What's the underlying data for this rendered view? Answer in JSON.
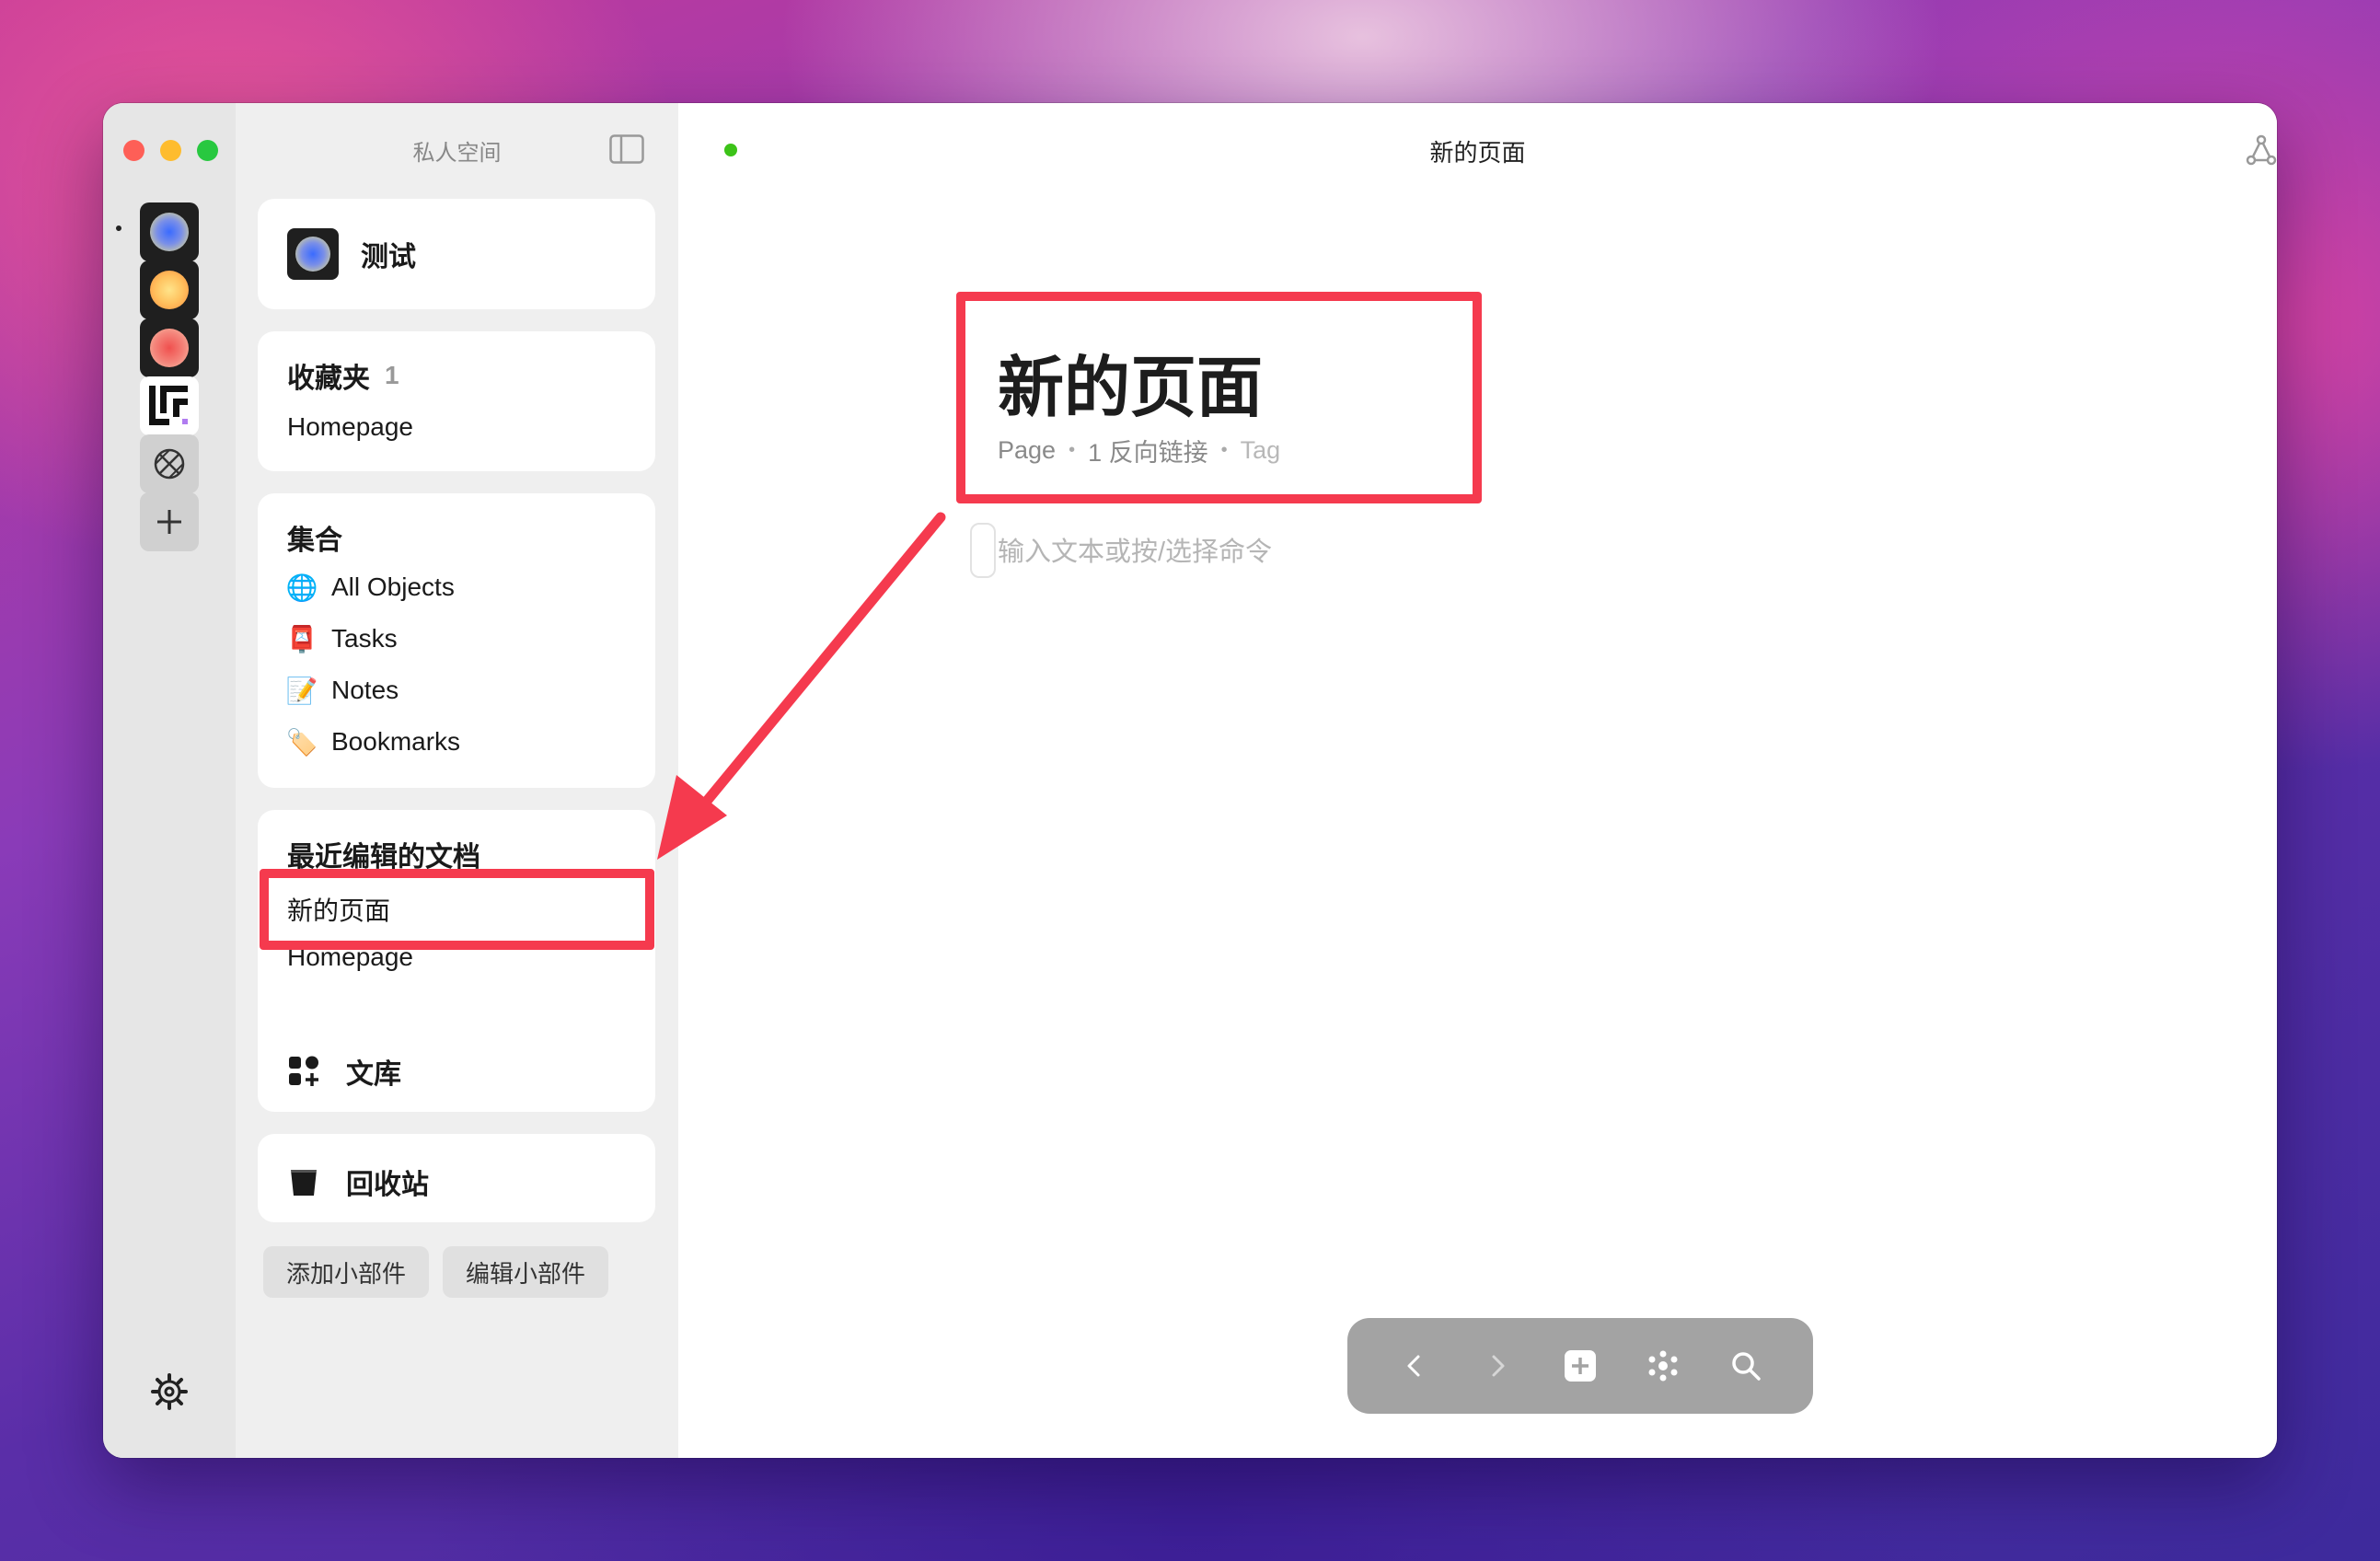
{
  "window": {
    "traffic_lights": [
      "close",
      "minimize",
      "zoom"
    ]
  },
  "spaces": {
    "items": [
      {
        "name": "space-blue",
        "colors": [
          "#2f6bff",
          "#f3e87a"
        ]
      },
      {
        "name": "space-orange",
        "colors": [
          "#ffd166",
          "#ff8c42"
        ]
      },
      {
        "name": "space-red",
        "colors": [
          "#ff6b5e",
          "#f7a8a0"
        ]
      },
      {
        "name": "space-logo",
        "glyph": "Ꮃ"
      },
      {
        "name": "space-globe",
        "icon": "globe-icon"
      },
      {
        "name": "add-space",
        "icon": "plus-icon"
      }
    ]
  },
  "sidebar": {
    "title": "私人空间",
    "space_name": "测试",
    "favorites": {
      "heading": "收藏夹",
      "count": "1",
      "items": [
        "Homepage"
      ]
    },
    "collections": {
      "heading": "集合",
      "items": [
        {
          "icon": "🌐",
          "label": "All Objects"
        },
        {
          "icon": "📮",
          "label": "Tasks"
        },
        {
          "icon": "📝",
          "label": "Notes"
        },
        {
          "icon": "🏷️",
          "label": "Bookmarks"
        }
      ]
    },
    "recent": {
      "heading": "最近编辑的文档",
      "items": [
        "新的页面",
        "Homepage"
      ]
    },
    "library_label": "文库",
    "trash_label": "回收站",
    "add_widget_label": "添加小部件",
    "edit_widget_label": "编辑小部件"
  },
  "main": {
    "header_title": "新的页面",
    "page_title": "新的页面",
    "meta": {
      "type": "Page",
      "backlinks": "1 反向链接",
      "tag": "Tag"
    },
    "placeholder": "输入文本或按/选择命令",
    "help_label": "?"
  },
  "colors": {
    "accent_annotation": "#f53a4e",
    "status_dot": "#3cc318",
    "toolbar_bg": "#a3a3a3"
  }
}
